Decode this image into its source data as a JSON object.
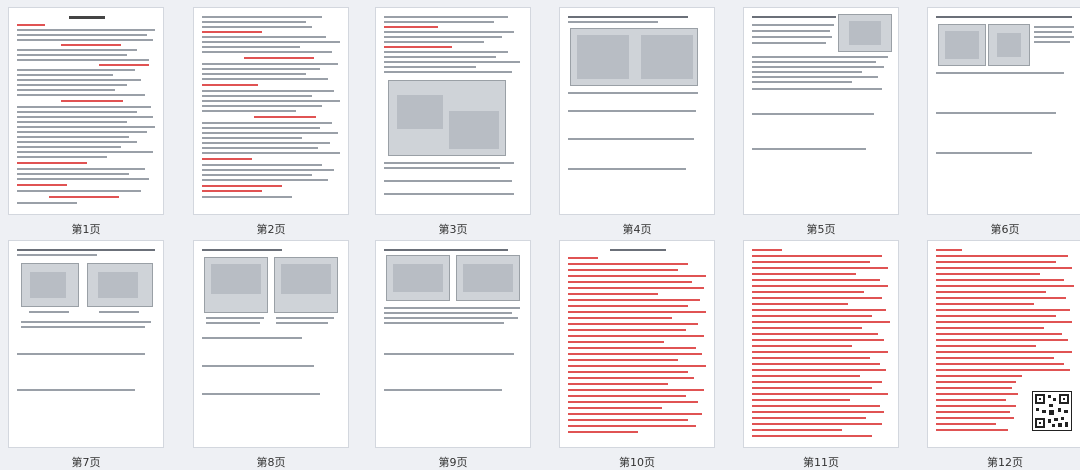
{
  "pages": [
    {
      "label": "第1页"
    },
    {
      "label": "第2页"
    },
    {
      "label": "第3页"
    },
    {
      "label": "第4页"
    },
    {
      "label": "第5页"
    },
    {
      "label": "第6页"
    },
    {
      "label": "第7页"
    },
    {
      "label": "第8页"
    },
    {
      "label": "第9页"
    },
    {
      "label": "第10页"
    },
    {
      "label": "第11页"
    },
    {
      "label": "第12页"
    }
  ]
}
